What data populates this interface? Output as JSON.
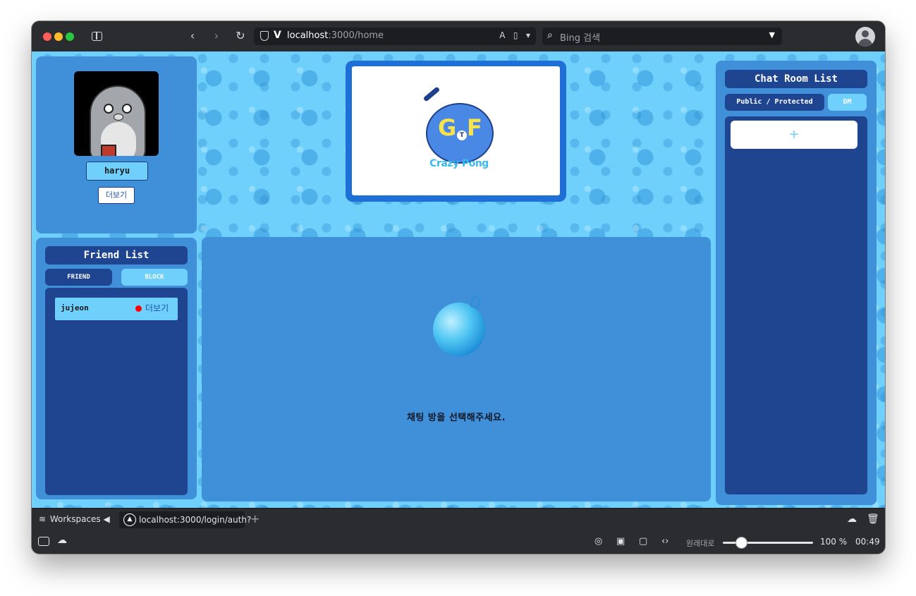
{
  "browser": {
    "url_host": "localhost",
    "url_path": ":3000/home",
    "search_placeholder": "Bing 검색"
  },
  "profile": {
    "username": "haryu",
    "more_label": "더보기"
  },
  "logo": {
    "letters_left": "G",
    "letters_mid": "T",
    "letters_right": "F",
    "caption": "Crazy Pong"
  },
  "friends": {
    "title": "Friend List",
    "tab_friend": "FRIEND",
    "tab_block": "BLOCK",
    "items": [
      {
        "name": "jujeon",
        "status_color": "#ff0000",
        "more_label": "더보기"
      }
    ]
  },
  "chat": {
    "empty_message": "채팅 방을 선택해주세요."
  },
  "chatrooms": {
    "title": "Chat Room List",
    "tab_public": "Public / Protected",
    "tab_dm": "DM",
    "add_label": "+"
  },
  "tabbar": {
    "workspaces_label": "Workspaces",
    "tab_label": "localhost:3000/login/auth?"
  },
  "statusbar": {
    "zoom_reset_label": "원래대로",
    "zoom_value": "100 %",
    "zoom_percent": 100,
    "clock": "00:49"
  },
  "colors": {
    "panel": "#3f8fd9",
    "dark_panel": "#1f4590",
    "light": "#6ed0fb",
    "background": "#6ed0fb"
  }
}
